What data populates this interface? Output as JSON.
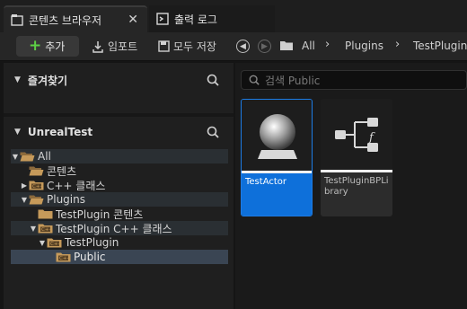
{
  "tabs": [
    {
      "label": "콘텐츠 브라우저",
      "icon": "content-browser-icon",
      "close": "✕"
    },
    {
      "label": "출력 로그",
      "icon": "output-log-icon"
    }
  ],
  "toolbar": {
    "add_label": "추가",
    "import_label": "임포트",
    "save_all_label": "모두 저장"
  },
  "breadcrumb": [
    "All",
    "Plugins",
    "TestPlugin"
  ],
  "favorites": {
    "title": "즐겨찾기"
  },
  "project": {
    "title": "UnrealTest"
  },
  "tree": [
    {
      "label": "All",
      "level": 0,
      "expanded": true,
      "folder": "open"
    },
    {
      "label": "콘텐츠",
      "level": 1,
      "expanded": false,
      "folder": "open"
    },
    {
      "label": "C++ 클래스",
      "level": 1,
      "expanded": false,
      "folder": "cpp"
    },
    {
      "label": "Plugins",
      "level": 1,
      "expanded": true,
      "folder": "open"
    },
    {
      "label": "TestPlugin 콘텐츠",
      "level": 2,
      "expanded": false,
      "folder": "closed"
    },
    {
      "label": "TestPlugin C++ 클래스",
      "level": 2,
      "expanded": true,
      "folder": "cpp"
    },
    {
      "label": "TestPlugin",
      "level": 3,
      "expanded": true,
      "folder": "cpp"
    },
    {
      "label": "Public",
      "level": 4,
      "expanded": false,
      "folder": "cpp",
      "selected": true
    }
  ],
  "search": {
    "placeholder": "검색 Public"
  },
  "assets": [
    {
      "label": "TestActor",
      "icon": "actor-sphere-icon",
      "selected": true
    },
    {
      "label": "TestPluginBPLibrary",
      "icon": "function-library-icon",
      "selected": false
    }
  ],
  "colors": {
    "accent": "#0e70da",
    "add_plus": "#5dcf45",
    "folder": "#c69a5a"
  }
}
